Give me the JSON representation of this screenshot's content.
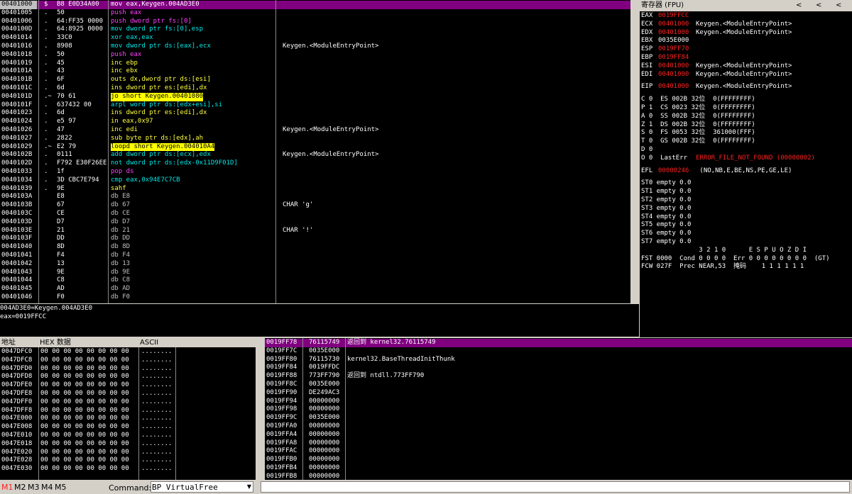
{
  "disasm": {
    "rows": [
      {
        "addr": "00401000",
        "m": "$",
        "hex": "B8 E0D34A00",
        "ins": "mov eax,Keygen.004AD3E0",
        "cmt": ""
      },
      {
        "addr": "00401005",
        "m": ".",
        "hex": "50",
        "ins": "push eax",
        "cmt": ""
      },
      {
        "addr": "00401006",
        "m": ".",
        "hex": "64:FF35 0000",
        "ins": "push dword ptr fs:[0]",
        "cmt": ""
      },
      {
        "addr": "0040100D",
        "m": ".",
        "hex": "64:8925 0000",
        "ins": "mov dword ptr fs:[0],esp",
        "cmt": ""
      },
      {
        "addr": "00401014",
        "m": ".",
        "hex": "33C0",
        "ins": "xor eax,eax",
        "cmt": ""
      },
      {
        "addr": "00401016",
        "m": ".",
        "hex": "8908",
        "ins": "mov dword ptr ds:[eax],ecx",
        "cmt": "Keygen.<ModuleEntryPoint>"
      },
      {
        "addr": "00401018",
        "m": ".",
        "hex": "50",
        "ins": "push eax",
        "cmt": ""
      },
      {
        "addr": "00401019",
        "m": ".",
        "hex": "45",
        "ins": "inc ebp",
        "cmt": ""
      },
      {
        "addr": "0040101A",
        "m": ".",
        "hex": "43",
        "ins": "inc ebx",
        "cmt": ""
      },
      {
        "addr": "0040101B",
        "m": ".",
        "hex": "6F",
        "ins": "outs dx,dword ptr ds:[esi]",
        "cmt": ""
      },
      {
        "addr": "0040101C",
        "m": ".",
        "hex": "6d",
        "ins": "ins dword ptr es:[edi],dx",
        "cmt": ""
      },
      {
        "addr": "0040101D",
        "m": ".~",
        "hex": "70 61",
        "ins": "jo short Keygen.00401080",
        "cmt": ""
      },
      {
        "addr": "0040101F",
        "m": ".",
        "hex": "637432 00",
        "ins": "arpl word ptr ds:[edx+esi],si",
        "cmt": ""
      },
      {
        "addr": "00401023",
        "m": ".",
        "hex": "6d",
        "ins": "ins dword ptr es:[edi],dx",
        "cmt": ""
      },
      {
        "addr": "00401024",
        "m": ".",
        "hex": "e5 97",
        "ins": "in eax,0x97",
        "cmt": ""
      },
      {
        "addr": "00401026",
        "m": ".",
        "hex": "47",
        "ins": "inc edi",
        "cmt": "Keygen.<ModuleEntryPoint>"
      },
      {
        "addr": "00401027",
        "m": ".",
        "hex": "2822",
        "ins": "sub byte ptr ds:[edx],ah",
        "cmt": ""
      },
      {
        "addr": "00401029",
        "m": ".~",
        "hex": "E2 79",
        "ins": "loopd short Keygen.004010A4",
        "cmt": ""
      },
      {
        "addr": "0040102B",
        "m": ".",
        "hex": "0111",
        "ins": "add dword ptr ds:[ecx],edx",
        "cmt": "Keygen.<ModuleEntryPoint>"
      },
      {
        "addr": "0040102D",
        "m": ".",
        "hex": "F792 E30F26EE",
        "ins": "not dword ptr ds:[edx-0x11D9F01D]",
        "cmt": ""
      },
      {
        "addr": "00401033",
        "m": ".",
        "hex": "1f",
        "ins": "pop ds",
        "cmt": ""
      },
      {
        "addr": "00401034",
        "m": ".",
        "hex": "3D CBC7E794",
        "ins": "cmp eax,0x94E7C7CB",
        "cmt": ""
      },
      {
        "addr": "00401039",
        "m": ".",
        "hex": "9E",
        "ins": "sahf",
        "cmt": ""
      },
      {
        "addr": "0040103A",
        "m": "",
        "hex": "E8",
        "ins": "db E8",
        "cmt": ""
      },
      {
        "addr": "0040103B",
        "m": "",
        "hex": "67",
        "ins": "db 67",
        "cmt": "CHAR 'g'"
      },
      {
        "addr": "0040103C",
        "m": "",
        "hex": "CE",
        "ins": "db CE",
        "cmt": ""
      },
      {
        "addr": "0040103D",
        "m": "",
        "hex": "D7",
        "ins": "db D7",
        "cmt": ""
      },
      {
        "addr": "0040103E",
        "m": "",
        "hex": "21",
        "ins": "db 21",
        "cmt": "CHAR '!'"
      },
      {
        "addr": "0040103F",
        "m": "",
        "hex": "DD",
        "ins": "db DD",
        "cmt": ""
      },
      {
        "addr": "00401040",
        "m": "",
        "hex": "8D",
        "ins": "db 8D",
        "cmt": ""
      },
      {
        "addr": "00401041",
        "m": "",
        "hex": "F4",
        "ins": "db F4",
        "cmt": ""
      },
      {
        "addr": "00401042",
        "m": "",
        "hex": "13",
        "ins": "db 13",
        "cmt": ""
      },
      {
        "addr": "00401043",
        "m": "",
        "hex": "9E",
        "ins": "db 9E",
        "cmt": ""
      },
      {
        "addr": "00401044",
        "m": "",
        "hex": "C8",
        "ins": "db C8",
        "cmt": ""
      },
      {
        "addr": "00401045",
        "m": "",
        "hex": "AD",
        "ins": "db AD",
        "cmt": ""
      },
      {
        "addr": "00401046",
        "m": "",
        "hex": "F0",
        "ins": "db F0",
        "cmt": ""
      }
    ],
    "info_line1": "004AD3E0=Keygen.004AD3E0",
    "info_line2": "eax=0019FFCC"
  },
  "registers": {
    "title": "寄存器 (FPU)",
    "nav": [
      "<",
      "<",
      "<"
    ],
    "gpr": [
      {
        "name": "EAX",
        "val": "0019FFCC",
        "cmt": "",
        "red": true
      },
      {
        "name": "ECX",
        "val": "00401000",
        "cmt": "Keygen.<ModuleEntryPoint>",
        "red": true
      },
      {
        "name": "EDX",
        "val": "00401000",
        "cmt": "Keygen.<ModuleEntryPoint>",
        "red": true
      },
      {
        "name": "EBX",
        "val": "0035E000",
        "cmt": "",
        "red": false
      },
      {
        "name": "ESP",
        "val": "0019FF70",
        "cmt": "",
        "red": true
      },
      {
        "name": "EBP",
        "val": "0019FF84",
        "cmt": "",
        "red": true
      },
      {
        "name": "ESI",
        "val": "00401000",
        "cmt": "Keygen.<ModuleEntryPoint>",
        "red": true
      },
      {
        "name": "EDI",
        "val": "00401000",
        "cmt": "Keygen.<ModuleEntryPoint>",
        "red": true
      }
    ],
    "eip": {
      "name": "EIP",
      "val": "00401000",
      "cmt": "Keygen.<ModuleEntryPoint>"
    },
    "flags": [
      "C 0  ES 002B 32位  0(FFFFFFFF)",
      "P 1  CS 0023 32位  0(FFFFFFFF)",
      "A 0  SS 002B 32位  0(FFFFFFFF)",
      "Z 1  DS 002B 32位  0(FFFFFFFF)",
      "S 0  FS 0053 32位  361000(FFF)",
      "T 0  GS 002B 32位  0(FFFFFFFF)",
      "D 0",
      "O 0  LastErr "
    ],
    "lasterr": "ERROR_FILE_NOT_FOUND (00000002)",
    "efl_label": "EFL",
    "efl_val": "00000246",
    "efl_desc": " (NO,NB,E,BE,NS,PE,GE,LE)",
    "st": [
      "ST0 empty 0.0",
      "ST1 empty 0.0",
      "ST2 empty 0.0",
      "ST3 empty 0.0",
      "ST4 empty 0.0",
      "ST5 empty 0.0",
      "ST6 empty 0.0",
      "ST7 empty 0.0"
    ],
    "fpu_hdr": "               3 2 1 0      E S P U O Z D I",
    "fst": "FST 0000  Cond 0 0 0 0  Err 0 0 0 0 0 0 0 0  (GT)",
    "fcw": "FCW 027F  Prec NEAR,53  掩码    1 1 1 1 1 1"
  },
  "dump": {
    "headers": [
      "地址",
      "HEX 数据",
      "ASCII"
    ],
    "rows": [
      {
        "addr": "0047DFC0",
        "hex": "00 00 00 00 00 00 00 00",
        "ascii": "........"
      },
      {
        "addr": "0047DFC8",
        "hex": "00 00 00 00 00 00 00 00",
        "ascii": "........"
      },
      {
        "addr": "0047DFD0",
        "hex": "00 00 00 00 00 00 00 00",
        "ascii": "........"
      },
      {
        "addr": "0047DFD8",
        "hex": "00 00 00 00 00 00 00 00",
        "ascii": "........"
      },
      {
        "addr": "0047DFE0",
        "hex": "00 00 00 00 00 00 00 00",
        "ascii": "........"
      },
      {
        "addr": "0047DFE8",
        "hex": "00 00 00 00 00 00 00 00",
        "ascii": "........"
      },
      {
        "addr": "0047DFF0",
        "hex": "00 00 00 00 00 00 00 00",
        "ascii": "........"
      },
      {
        "addr": "0047DFF8",
        "hex": "00 00 00 00 00 00 00 00",
        "ascii": "........"
      },
      {
        "addr": "0047E000",
        "hex": "00 00 00 00 00 00 00 00",
        "ascii": "........"
      },
      {
        "addr": "0047E008",
        "hex": "00 00 00 00 00 00 00 00",
        "ascii": "........"
      },
      {
        "addr": "0047E010",
        "hex": "00 00 00 00 00 00 00 00",
        "ascii": "........"
      },
      {
        "addr": "0047E018",
        "hex": "00 00 00 00 00 00 00 00",
        "ascii": "........"
      },
      {
        "addr": "0047E020",
        "hex": "00 00 00 00 00 00 00 00",
        "ascii": "........"
      },
      {
        "addr": "0047E028",
        "hex": "00 00 00 00 00 00 00 00",
        "ascii": "........"
      },
      {
        "addr": "0047E030",
        "hex": "00 00 00 00 00 00 00 00",
        "ascii": "........"
      }
    ]
  },
  "stack": {
    "rows": [
      {
        "addr": "0019FF78",
        "val": "76115749",
        "cmt": "返回到 kernel32.76115749",
        "sel": true
      },
      {
        "addr": "0019FF7C",
        "val": "0035E000",
        "cmt": ""
      },
      {
        "addr": "0019FF80",
        "val": "76115730",
        "cmt": "kernel32.BaseThreadInitThunk"
      },
      {
        "addr": "0019FF84",
        "val": "0019FFDC",
        "cmt": ""
      },
      {
        "addr": "0019FF88",
        "val": "773FF790",
        "cmt": "返回到 ntdll.773FF790"
      },
      {
        "addr": "0019FF8C",
        "val": "0035E000",
        "cmt": ""
      },
      {
        "addr": "0019FF90",
        "val": "DE249AC3",
        "cmt": ""
      },
      {
        "addr": "0019FF94",
        "val": "00000000",
        "cmt": ""
      },
      {
        "addr": "0019FF98",
        "val": "00000000",
        "cmt": ""
      },
      {
        "addr": "0019FF9C",
        "val": "0035E000",
        "cmt": ""
      },
      {
        "addr": "0019FFA0",
        "val": "00000000",
        "cmt": ""
      },
      {
        "addr": "0019FFA4",
        "val": "00000000",
        "cmt": ""
      },
      {
        "addr": "0019FFA8",
        "val": "00000000",
        "cmt": ""
      },
      {
        "addr": "0019FFAC",
        "val": "00000000",
        "cmt": ""
      },
      {
        "addr": "0019FFB0",
        "val": "00000000",
        "cmt": ""
      },
      {
        "addr": "0019FFB4",
        "val": "00000000",
        "cmt": ""
      },
      {
        "addr": "0019FFB8",
        "val": "00000000",
        "cmt": ""
      }
    ]
  },
  "bottombar": {
    "tabs": [
      "M1",
      "M2",
      "M3",
      "M4",
      "M5"
    ],
    "command_label": "Command:",
    "command_value": "BP VirtualFree"
  },
  "colors": {
    "red": "#ff2020",
    "cyan": "#00e8e8",
    "magenta": "#ff40ff",
    "yellow": "#ffff40",
    "accent": "#800080"
  }
}
